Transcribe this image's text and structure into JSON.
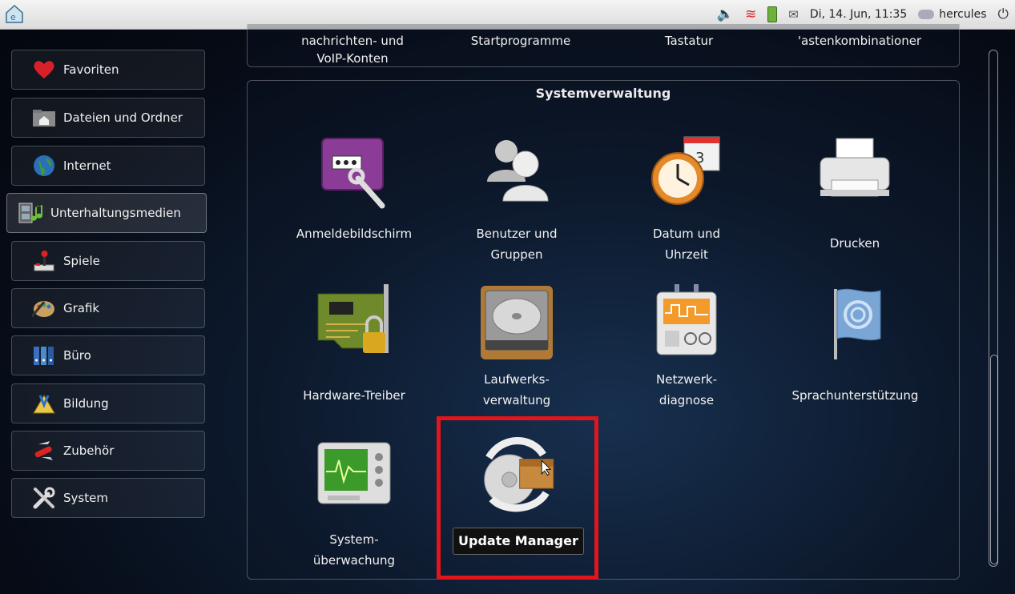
{
  "panel": {
    "datetime": "Di, 14. Jun, 11:35",
    "user": "hercules"
  },
  "sidebar": {
    "items": [
      {
        "label": "Favoriten",
        "icon": "heart-icon"
      },
      {
        "label": "Dateien und Ordner",
        "icon": "folder-home-icon"
      },
      {
        "label": "Internet",
        "icon": "globe-icon"
      },
      {
        "label": "Unterhaltungsmedien",
        "icon": "multimedia-icon"
      },
      {
        "label": "Spiele",
        "icon": "joystick-icon"
      },
      {
        "label": "Grafik",
        "icon": "palette-icon"
      },
      {
        "label": "Büro",
        "icon": "binders-icon"
      },
      {
        "label": "Bildung",
        "icon": "compass-icon"
      },
      {
        "label": "Zubehör",
        "icon": "swiss-knife-icon"
      },
      {
        "label": "System",
        "icon": "tools-icon"
      }
    ]
  },
  "top_row": {
    "items": [
      "nachrichten- und\nVoIP-Konten",
      "Startprogramme",
      "Tastatur",
      "'astenkombinationer"
    ]
  },
  "section": {
    "title": "Systemverwaltung",
    "apps": [
      {
        "label": "Anmeldebildschirm",
        "icon": "login-screen-icon"
      },
      {
        "label": "Benutzer und Gruppen",
        "icon": "users-icon"
      },
      {
        "label": "Datum und Uhrzeit",
        "icon": "clock-calendar-icon"
      },
      {
        "label": "Drucken",
        "icon": "printer-icon"
      },
      {
        "label": "Hardware-Treiber",
        "icon": "hardware-driver-icon"
      },
      {
        "label": "Laufwerks- verwaltung",
        "icon": "hard-disk-icon"
      },
      {
        "label": "Netzwerk- diagnose",
        "icon": "network-diagnostics-icon"
      },
      {
        "label": "Sprachunterstützung",
        "icon": "language-flag-icon"
      },
      {
        "label": "System- überwachung",
        "icon": "system-monitor-icon"
      },
      {
        "label": "Update Manager",
        "icon": "update-manager-icon"
      }
    ]
  },
  "tooltip": "Update Manager",
  "colors": {
    "highlight": "#e3151c"
  }
}
